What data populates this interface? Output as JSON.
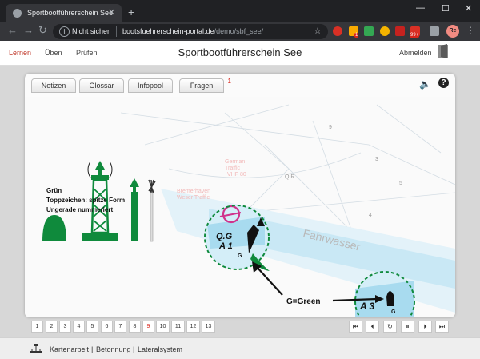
{
  "browser": {
    "tab_title": "Sportbootführerschein See",
    "insecure_label": "Nicht sicher",
    "url_host": "bootsfuehrerschein-portal.de",
    "url_path": "/demo/sbf_see/",
    "ext_badge_99": "99+",
    "ext_badge_small": "1",
    "profile_initials": "Re"
  },
  "app": {
    "nav": [
      "Lernen",
      "Üben",
      "Prüfen"
    ],
    "title": "Sportbootführerschein See",
    "logout": "Abmelden"
  },
  "card": {
    "tabs": [
      {
        "label": "Notizen"
      },
      {
        "label": "Glossar"
      },
      {
        "label": "Infopool"
      },
      {
        "label": "Fragen",
        "count": "1"
      }
    ]
  },
  "content": {
    "description": [
      "Grün",
      "Toppzeichen: spitze Form",
      "Ungerade nummeriert"
    ],
    "chart_labels": {
      "fahrwasser": "Fahrwasser",
      "buoy_qg": "Q.G",
      "buoy_a1": "A 1",
      "buoy_g": "G",
      "buoy_a3": "A 3",
      "buoy_g2": "G",
      "callout": "G=Green",
      "german": "German",
      "traffic": "Traffic",
      "vhf": "VHF 80",
      "bremerhaven": "Bremerhaven",
      "weser": "Weser Traffic",
      "qr": "Q.R",
      "num_3": "3",
      "num_5": "5",
      "num_4": "4",
      "num_9": "9"
    }
  },
  "pager": {
    "pages": [
      "1",
      "2",
      "3",
      "4",
      "5",
      "6",
      "7",
      "8",
      "9",
      "10",
      "11",
      "12",
      "13"
    ],
    "active": "9"
  },
  "breadcrumb": [
    "Kartenarbeit",
    "Betonnung",
    "Lateralsystem"
  ],
  "colors": {
    "buoy_green": "#0f8a3c",
    "active_nav": "#c0392b",
    "badge_red": "#d9261c",
    "water_blue": "#bfe4f2"
  }
}
